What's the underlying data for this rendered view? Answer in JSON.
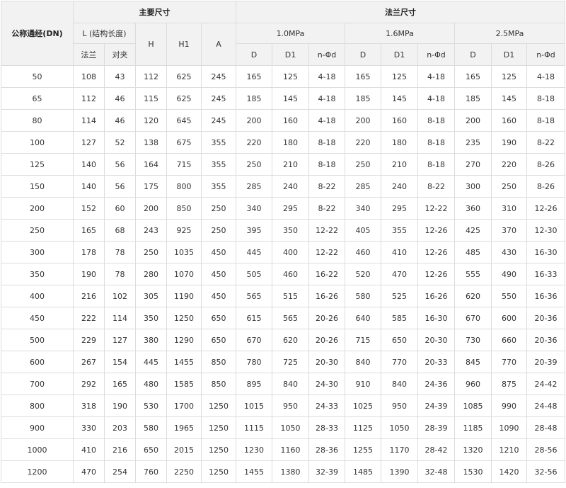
{
  "headers": {
    "dn": "公称通经(DN)",
    "main": "主要尺寸",
    "flange": "法兰尺寸",
    "length": "L (结构长度)",
    "flange_type": "法兰",
    "wafer_type": "对夹",
    "H": "H",
    "H1": "H1",
    "A": "A",
    "p1": "1.0MPa",
    "p2": "1.6MPa",
    "p3": "2.5MPa",
    "D": "D",
    "D1": "D1",
    "nd": "n-Φd"
  },
  "rows": [
    [
      "50",
      "108",
      "43",
      "112",
      "625",
      "245",
      "165",
      "125",
      "4-18",
      "165",
      "125",
      "4-18",
      "165",
      "125",
      "4-18"
    ],
    [
      "65",
      "112",
      "46",
      "115",
      "625",
      "245",
      "185",
      "145",
      "4-18",
      "185",
      "145",
      "4-18",
      "185",
      "145",
      "8-18"
    ],
    [
      "80",
      "114",
      "46",
      "120",
      "645",
      "245",
      "200",
      "160",
      "4-18",
      "200",
      "160",
      "8-18",
      "200",
      "160",
      "8-18"
    ],
    [
      "100",
      "127",
      "52",
      "138",
      "675",
      "355",
      "220",
      "180",
      "8-18",
      "220",
      "180",
      "8-18",
      "235",
      "190",
      "8-22"
    ],
    [
      "125",
      "140",
      "56",
      "164",
      "715",
      "355",
      "250",
      "210",
      "8-18",
      "250",
      "210",
      "8-18",
      "270",
      "220",
      "8-26"
    ],
    [
      "150",
      "140",
      "56",
      "175",
      "800",
      "355",
      "285",
      "240",
      "8-22",
      "285",
      "240",
      "8-22",
      "300",
      "250",
      "8-26"
    ],
    [
      "200",
      "152",
      "60",
      "200",
      "850",
      "250",
      "340",
      "295",
      "8-22",
      "340",
      "295",
      "12-22",
      "360",
      "310",
      "12-26"
    ],
    [
      "250",
      "165",
      "68",
      "243",
      "925",
      "250",
      "395",
      "350",
      "12-22",
      "405",
      "355",
      "12-26",
      "425",
      "370",
      "12-30"
    ],
    [
      "300",
      "178",
      "78",
      "250",
      "1035",
      "450",
      "445",
      "400",
      "12-22",
      "460",
      "410",
      "12-26",
      "485",
      "430",
      "16-30"
    ],
    [
      "350",
      "190",
      "78",
      "280",
      "1070",
      "450",
      "505",
      "460",
      "16-22",
      "520",
      "470",
      "12-26",
      "555",
      "490",
      "16-33"
    ],
    [
      "400",
      "216",
      "102",
      "305",
      "1190",
      "450",
      "565",
      "515",
      "16-26",
      "580",
      "525",
      "16-26",
      "620",
      "550",
      "16-36"
    ],
    [
      "450",
      "222",
      "114",
      "350",
      "1250",
      "650",
      "615",
      "565",
      "20-26",
      "640",
      "585",
      "16-30",
      "670",
      "600",
      "20-36"
    ],
    [
      "500",
      "229",
      "127",
      "380",
      "1290",
      "650",
      "670",
      "620",
      "20-26",
      "715",
      "650",
      "20-30",
      "730",
      "660",
      "20-36"
    ],
    [
      "600",
      "267",
      "154",
      "445",
      "1455",
      "850",
      "780",
      "725",
      "20-30",
      "840",
      "770",
      "20-33",
      "845",
      "770",
      "20-39"
    ],
    [
      "700",
      "292",
      "165",
      "480",
      "1585",
      "850",
      "895",
      "840",
      "24-30",
      "910",
      "840",
      "24-36",
      "960",
      "875",
      "24-42"
    ],
    [
      "800",
      "318",
      "190",
      "530",
      "1700",
      "1250",
      "1015",
      "950",
      "24-33",
      "1025",
      "950",
      "24-39",
      "1085",
      "990",
      "24-48"
    ],
    [
      "900",
      "330",
      "203",
      "580",
      "1965",
      "1250",
      "1115",
      "1050",
      "28-33",
      "1125",
      "1050",
      "28-39",
      "1185",
      "1090",
      "28-48"
    ],
    [
      "1000",
      "410",
      "216",
      "650",
      "2015",
      "1250",
      "1230",
      "1160",
      "28-36",
      "1255",
      "1170",
      "28-42",
      "1320",
      "1210",
      "28-56"
    ],
    [
      "1200",
      "470",
      "254",
      "760",
      "2250",
      "1250",
      "1455",
      "1380",
      "32-39",
      "1485",
      "1390",
      "32-48",
      "1530",
      "1420",
      "32-56"
    ]
  ]
}
